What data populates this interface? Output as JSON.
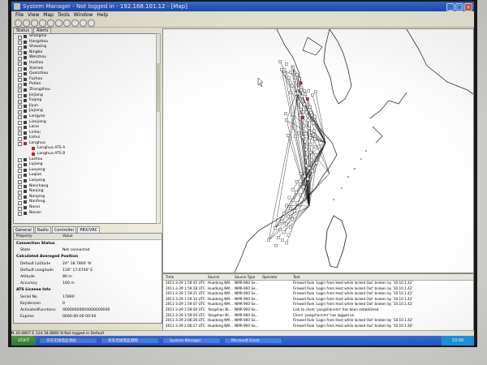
{
  "window": {
    "title": "System Manager - Not logged in - 192.168.101.12 - [Map]"
  },
  "menu": [
    "File",
    "View",
    "Map",
    "Tools",
    "Window",
    "Help"
  ],
  "tree_tabs": [
    "Status",
    "Alerts"
  ],
  "tree": [
    {
      "label": "Shanghai",
      "child": false,
      "red": false
    },
    {
      "label": "Hangzhou",
      "child": false,
      "red": false
    },
    {
      "label": "Shaoxing",
      "child": false,
      "red": false
    },
    {
      "label": "Ningbo",
      "child": false,
      "red": false
    },
    {
      "label": "Wenzhou",
      "child": false,
      "red": false
    },
    {
      "label": "Huzhou",
      "child": false,
      "red": false
    },
    {
      "label": "Xiamen",
      "child": false,
      "red": false
    },
    {
      "label": "Quanzhou",
      "child": false,
      "red": false
    },
    {
      "label": "Fuzhou",
      "child": false,
      "red": false
    },
    {
      "label": "Putian",
      "child": false,
      "red": false
    },
    {
      "label": "Zhangzhou",
      "child": false,
      "red": false
    },
    {
      "label": "Jinjiang",
      "child": false,
      "red": false
    },
    {
      "label": "Fuqing",
      "child": false,
      "red": false
    },
    {
      "label": "Jiyun",
      "child": false,
      "red": false
    },
    {
      "label": "Jiujiang",
      "child": false,
      "red": false
    },
    {
      "label": "Longyan",
      "child": false,
      "red": false
    },
    {
      "label": "Lianjiang",
      "child": false,
      "red": false
    },
    {
      "label": "Lanxi",
      "child": false,
      "red": false
    },
    {
      "label": "Linhai",
      "child": false,
      "red": false
    },
    {
      "label": "Lishui",
      "child": false,
      "red": false
    },
    {
      "label": "Longhua",
      "child": false,
      "red": true
    },
    {
      "label": "Longhua ATS A",
      "child": true,
      "red": true
    },
    {
      "label": "Longhua ATS B",
      "child": true,
      "red": true
    },
    {
      "label": "Luzhou",
      "child": false,
      "red": false
    },
    {
      "label": "Lujiang",
      "child": false,
      "red": false
    },
    {
      "label": "Luoyang",
      "child": false,
      "red": false
    },
    {
      "label": "Luqiao",
      "child": false,
      "red": false
    },
    {
      "label": "Lueyang",
      "child": false,
      "red": false
    },
    {
      "label": "Nanchang",
      "child": false,
      "red": false
    },
    {
      "label": "Nanjing",
      "child": false,
      "red": false
    },
    {
      "label": "Nanping",
      "child": false,
      "red": false
    },
    {
      "label": "Nanfeng",
      "child": false,
      "red": false
    },
    {
      "label": "Nanxi",
      "child": false,
      "red": false
    },
    {
      "label": "Nanan",
      "child": false,
      "red": false
    }
  ],
  "lower_tabs": [
    "General",
    "Radio",
    "Controller",
    "PBX/VRC"
  ],
  "props": {
    "header_key": "Property",
    "header_val": "Value",
    "rows": [
      {
        "k": "Connection Status",
        "v": "",
        "sec": true
      },
      {
        "k": "State",
        "v": "Not connected",
        "sec": false
      },
      {
        "k": "Calculated Averaged Position",
        "v": "",
        "sec": true
      },
      {
        "k": "Default Latitude",
        "v": "24° 18.7800' N",
        "sec": false
      },
      {
        "k": "Default Longitude",
        "v": "118° 17.6740' E",
        "sec": false
      },
      {
        "k": "Altitude",
        "v": "80 m",
        "sec": false
      },
      {
        "k": "Accuracy",
        "v": "100 m",
        "sec": false
      },
      {
        "k": "ATS License Info",
        "v": "",
        "sec": true
      },
      {
        "k": "Serial No",
        "v": "17890",
        "sec": false
      },
      {
        "k": "KeyVersion",
        "v": "0",
        "sec": false
      },
      {
        "k": "ActivatedFunctions",
        "v": "00000000000000000000",
        "sec": false
      },
      {
        "k": "Expires",
        "v": "0000-00-00 00:00",
        "sec": false
      }
    ]
  },
  "log": {
    "headers": {
      "time": "Time",
      "source": "Source",
      "type": "Source Type",
      "operator": "Operator",
      "text": "Text"
    },
    "rows": [
      {
        "time": "2011-3-29 1:59:45 UTC",
        "source": "Huadong NM...",
        "type": "NMR-900 Se...",
        "operator": "",
        "text": "Firewall Rule 'Login from Host while locked Out' broken by '10.10.1.42'"
      },
      {
        "time": "2011-3-29 1:59:28 UTC",
        "source": "Huadong NM...",
        "type": "NMR-900 Se...",
        "operator": "",
        "text": "Firewall Rule 'Login from Host while locked Out' broken by '10.10.1.42'"
      },
      {
        "time": "2011-3-29 1:59:21 UTC",
        "source": "Huadong NM...",
        "type": "NMR-900 Se...",
        "operator": "",
        "text": "Firewall Rule 'Login from Host while locked Out' broken by '10.10.1.42'"
      },
      {
        "time": "2011-3-29 1:59:14 UTC",
        "source": "Huadong NM...",
        "type": "NMR-900 Se...",
        "operator": "",
        "text": "Firewall Rule 'Login from Host while locked Out' broken by '10.10.1.42'"
      },
      {
        "time": "2011-3-29 1:59:07 UTC",
        "source": "Huadong NM...",
        "type": "NMR-900 Se...",
        "operator": "",
        "text": "Firewall Rule 'Login from Host while locked Out' broken by '10.10.1.42'"
      },
      {
        "time": "2011-3-29 1:59:04 UTC",
        "source": "Yangshan NI...",
        "type": "NMR-900 Se...",
        "operator": "",
        "text": "Link to client 'yangshannmr' has been established"
      },
      {
        "time": "2011-3-29 1:59:04 UTC",
        "source": "Yangshan NI...",
        "type": "NMR-900 Se...",
        "operator": "",
        "text": "Client 'yangshannmr' has logged on"
      },
      {
        "time": "2011-3-29 2:00:26 UTC",
        "source": "Huadong NM...",
        "type": "NMR-900 Se...",
        "operator": "",
        "text": "Firewall Rule 'Login from Host while locked Out' broken by '10.10.1.42'"
      },
      {
        "time": "2011-3-29 2:00:27 UTC",
        "source": "Huadong NM...",
        "type": "NMR-900 Se...",
        "operator": "",
        "text": "Firewall Rule 'Login from Host while locked Out' broken by '10.10.1.40'"
      }
    ]
  },
  "status_bar": "N 30.0807  E 114 34.8885  N    Not logged in    Default",
  "taskbar": {
    "start": "start",
    "tasks": [
      "华东无线电监测站",
      "华东无线电监测网",
      "System Manager",
      "Microsoft Excel"
    ],
    "clock": "10:00"
  },
  "colors": {
    "map_line": "#111111",
    "alert_node": "#c0282a",
    "node_fill": "#ffffff",
    "coast": "#333333"
  }
}
